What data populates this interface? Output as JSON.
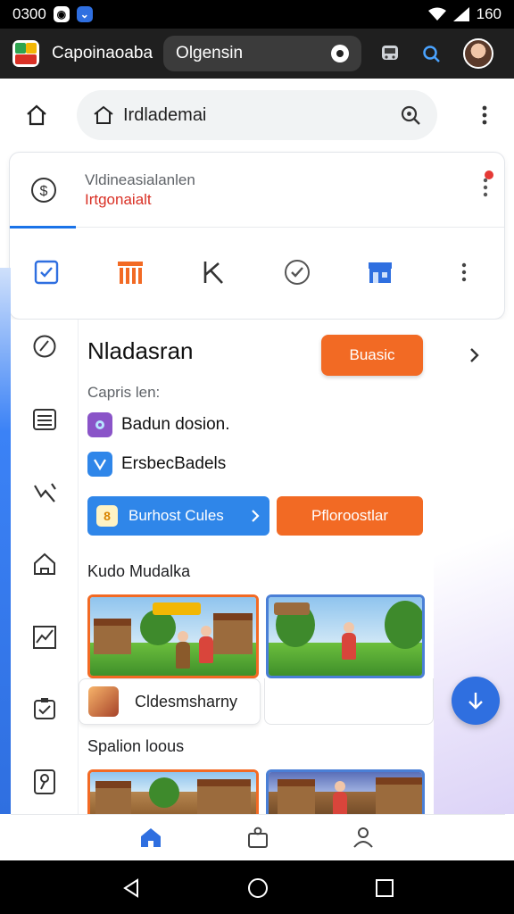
{
  "status_bar": {
    "left_text": "0300",
    "right_text": "160"
  },
  "app_bar": {
    "title": "Capoinaoaba",
    "search_text": "Olgensin"
  },
  "address_bar": {
    "text": "Irdlademai"
  },
  "card": {
    "line1": "Vldineasialanlen",
    "line2": "Irtgonaialt"
  },
  "main": {
    "title": "Nladasran",
    "primary_button": "Buasic",
    "caption": "Capris len:",
    "list_items": [
      {
        "label": "Badun dosion."
      },
      {
        "label": "ErsbecBadels"
      }
    ],
    "blue_button": {
      "badge": "8",
      "label": "Burhost Cules"
    },
    "orange_button": "Pfloroostlar",
    "section1": "Kudo Mudalka",
    "game_card_label": "Cldesmsharny",
    "section2": "Spalion loous"
  },
  "colors": {
    "accent_blue": "#2f6fe0",
    "accent_orange": "#f26a24",
    "alert_red": "#d93025"
  },
  "icons": {
    "tool_row": [
      "checkbox-icon",
      "columns-icon",
      "k-letter-icon",
      "check-circle-icon",
      "storefront-icon",
      "more-vert-icon"
    ],
    "rail": [
      "compass-icon",
      "list-icon",
      "chart-down-icon",
      "home-outline-icon",
      "trend-chart-icon",
      "clipboard-check-icon",
      "pin-icon"
    ],
    "bottom_nav": [
      "home-icon",
      "profile-badge-icon",
      "account-icon"
    ]
  }
}
